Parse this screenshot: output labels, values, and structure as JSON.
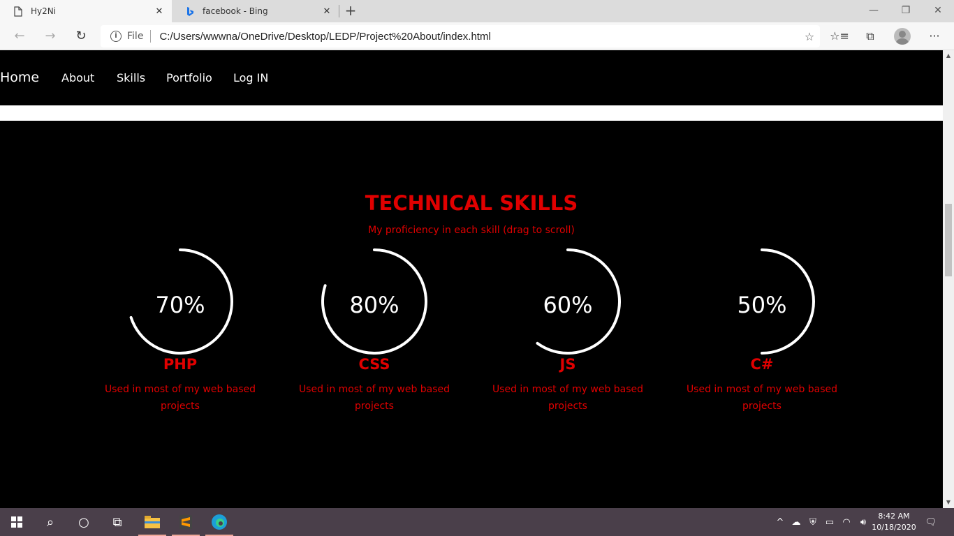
{
  "browser": {
    "tabs": [
      {
        "title": "Hy2Ni",
        "active": true
      },
      {
        "title": "facebook - Bing",
        "active": false
      }
    ],
    "address": {
      "scheme": "File",
      "url": "C:/Users/wwwna/OneDrive/Desktop/LEDP/Project%20About/index.html"
    }
  },
  "site_nav": {
    "items": [
      "Home",
      "About",
      "Skills",
      "Portfolio",
      "Log IN"
    ]
  },
  "skills_section": {
    "title": "TECHNICAL SKILLS",
    "subtitle": "My proficiency in each skill (drag to scroll)",
    "skills": [
      {
        "percent_label": "70%",
        "percent": 70,
        "name": "PHP",
        "description": "Used in most of my web based projects"
      },
      {
        "percent_label": "80%",
        "percent": 80,
        "name": "CSS",
        "description": "Used in most of my web based projects"
      },
      {
        "percent_label": "60%",
        "percent": 60,
        "name": "JS",
        "description": "Used in most of my web based projects"
      },
      {
        "percent_label": "50%",
        "percent": 50,
        "name": "C#",
        "description": "Used in most of my web based projects"
      }
    ],
    "accent_color": "#e00000",
    "ring_color": "#ffffff"
  },
  "taskbar": {
    "time": "8:42 AM",
    "date": "10/18/2020"
  }
}
